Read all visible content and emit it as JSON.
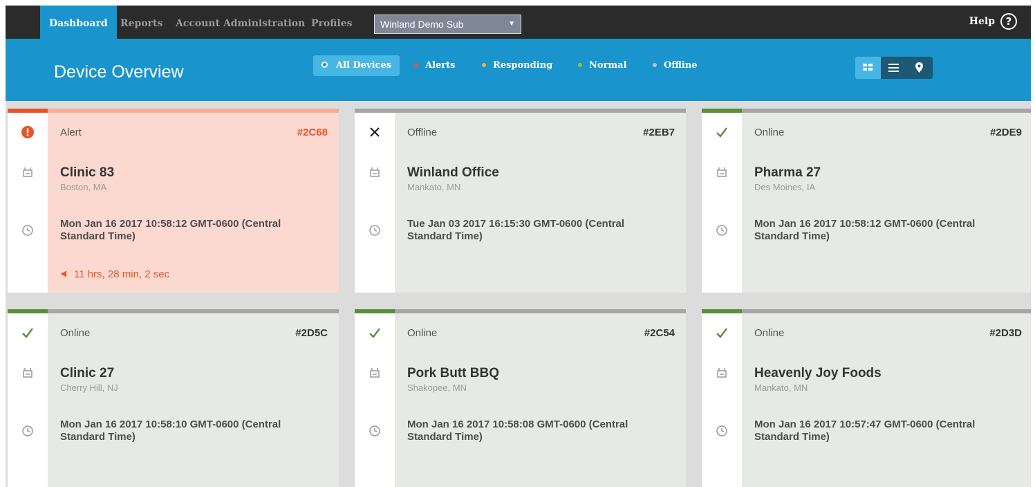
{
  "nav": {
    "tabs": [
      {
        "label": "Dashboard"
      },
      {
        "label": "Reports"
      },
      {
        "label": "Account Administration"
      },
      {
        "label": "Profiles"
      }
    ],
    "account_select": {
      "value": "Winland Demo Sub"
    },
    "help_label": "Help",
    "help_icon_glyph": "?"
  },
  "header": {
    "title": "Device Overview",
    "filters": [
      {
        "label": "All Devices",
        "color": "#1a94cc"
      },
      {
        "label": "Alerts",
        "color": "#e8542a"
      },
      {
        "label": "Responding",
        "color": "#f0b232"
      },
      {
        "label": "Normal",
        "color": "#8cc63e"
      },
      {
        "label": "Offline",
        "color": "#a6a6a6"
      }
    ],
    "views": [
      "grid-view-icon",
      "list-view-icon",
      "map-view-icon"
    ]
  },
  "colors": {
    "nav_bg": "#2b2b2b",
    "brand_blue": "#1a94cc",
    "alert": "#e8542a",
    "online": "#5a8f3a",
    "offline_bar": "#a6a6a6"
  },
  "cards": [
    {
      "status": "Alert",
      "id": "#2C68",
      "name": "Clinic 83",
      "location": "Boston, MA",
      "timestamp": "Mon Jan 16 2017 10:58:12 GMT-0600 (Central Standard Time)",
      "duration": "11 hrs, 28 min, 2 sec",
      "status_icon": "alert-icon"
    },
    {
      "status": "Offline",
      "id": "#2EB7",
      "name": "Winland Office",
      "location": "Mankato, MN",
      "timestamp": "Tue Jan 03 2017 16:15:30 GMT-0600 (Central Standard Time)",
      "status_icon": "close-icon"
    },
    {
      "status": "Online",
      "id": "#2DE9",
      "name": "Pharma 27",
      "location": "Des Moines, IA",
      "timestamp": "Mon Jan 16 2017 10:58:12 GMT-0600 (Central Standard Time)",
      "status_icon": "check-icon"
    },
    {
      "status": "Online",
      "id": "#2D5C",
      "name": "Clinic 27",
      "location": "Cherry Hill, NJ",
      "timestamp": "Mon Jan 16 2017 10:58:10 GMT-0600 (Central Standard Time)",
      "status_icon": "check-icon"
    },
    {
      "status": "Online",
      "id": "#2C54",
      "name": "Pork Butt BBQ",
      "location": "Shakopee, MN",
      "timestamp": "Mon Jan 16 2017 10:58:08 GMT-0600 (Central Standard Time)",
      "status_icon": "check-icon"
    },
    {
      "status": "Online",
      "id": "#2D3D",
      "name": "Heavenly Joy Foods",
      "location": "Mankato, MN",
      "timestamp": "Mon Jan 16 2017 10:57:47 GMT-0600 (Central Standard Time)",
      "status_icon": "check-icon"
    }
  ]
}
